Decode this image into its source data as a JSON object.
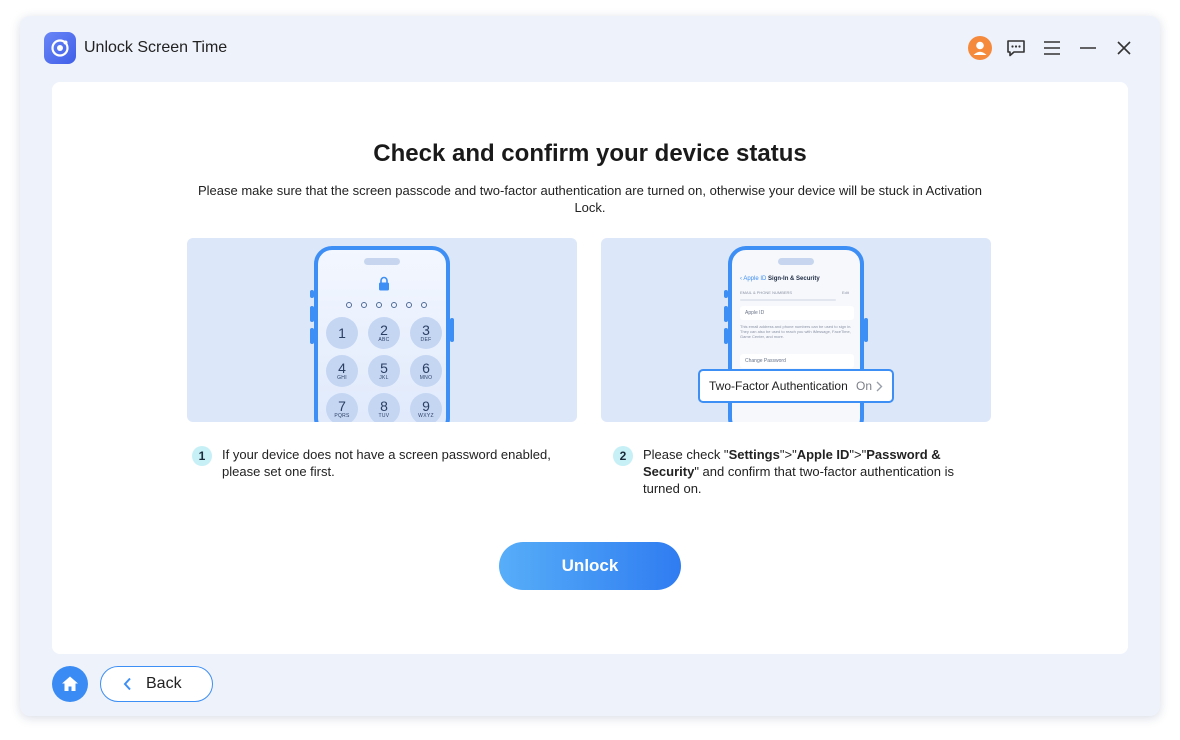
{
  "app": {
    "title": "Unlock Screen Time",
    "colors": {
      "accent": "#3d8ef5",
      "avatar": "#f58a3c",
      "button_gradient_start": "#57aef8",
      "button_gradient_end": "#2f7cf1"
    }
  },
  "titlebar": {
    "icons": [
      "user-avatar-icon",
      "feedback-icon",
      "menu-icon",
      "minimize-icon",
      "close-icon"
    ]
  },
  "main": {
    "heading": "Check and confirm your device status",
    "subtext": "Please make sure that the screen passcode and two-factor authentication are turned on, otherwise your device will be stuck in Activation Lock.",
    "keypad": [
      {
        "num": "1",
        "sub": ""
      },
      {
        "num": "2",
        "sub": "ABC"
      },
      {
        "num": "3",
        "sub": "DEF"
      },
      {
        "num": "4",
        "sub": "GHI"
      },
      {
        "num": "5",
        "sub": "JKL"
      },
      {
        "num": "6",
        "sub": "MNO"
      },
      {
        "num": "7",
        "sub": "PQRS"
      },
      {
        "num": "8",
        "sub": "TUV"
      },
      {
        "num": "9",
        "sub": "WXYZ"
      }
    ],
    "settings_preview": {
      "back": "Apple ID",
      "title": "Sign-In & Security",
      "section_label": "EMAIL & PHONE NUMBERS",
      "edit_label": "Edit",
      "field_apple_id": "Apple ID",
      "note": "This email address and phone numbers can be used to sign in. They can also be used to reach you with iMessage, FaceTime, Game Center, and more.",
      "change_password": "Change Password",
      "tfa_label": "Two-Factor Authentication",
      "tfa_value": "On"
    },
    "steps": [
      {
        "number": "1",
        "text": "If your device does not have a screen password enabled, please set one first."
      },
      {
        "number": "2",
        "prefix": "Please check \"",
        "settings": "Settings",
        "sep1": "\">\"",
        "apple_id": "Apple ID",
        "sep2": "\">\"",
        "password_security": "Password & Security",
        "suffix": "\" and confirm that two-factor authentication is turned on."
      }
    ],
    "unlock_label": "Unlock"
  },
  "footer": {
    "home_icon": "home-icon",
    "back_label": "Back"
  }
}
